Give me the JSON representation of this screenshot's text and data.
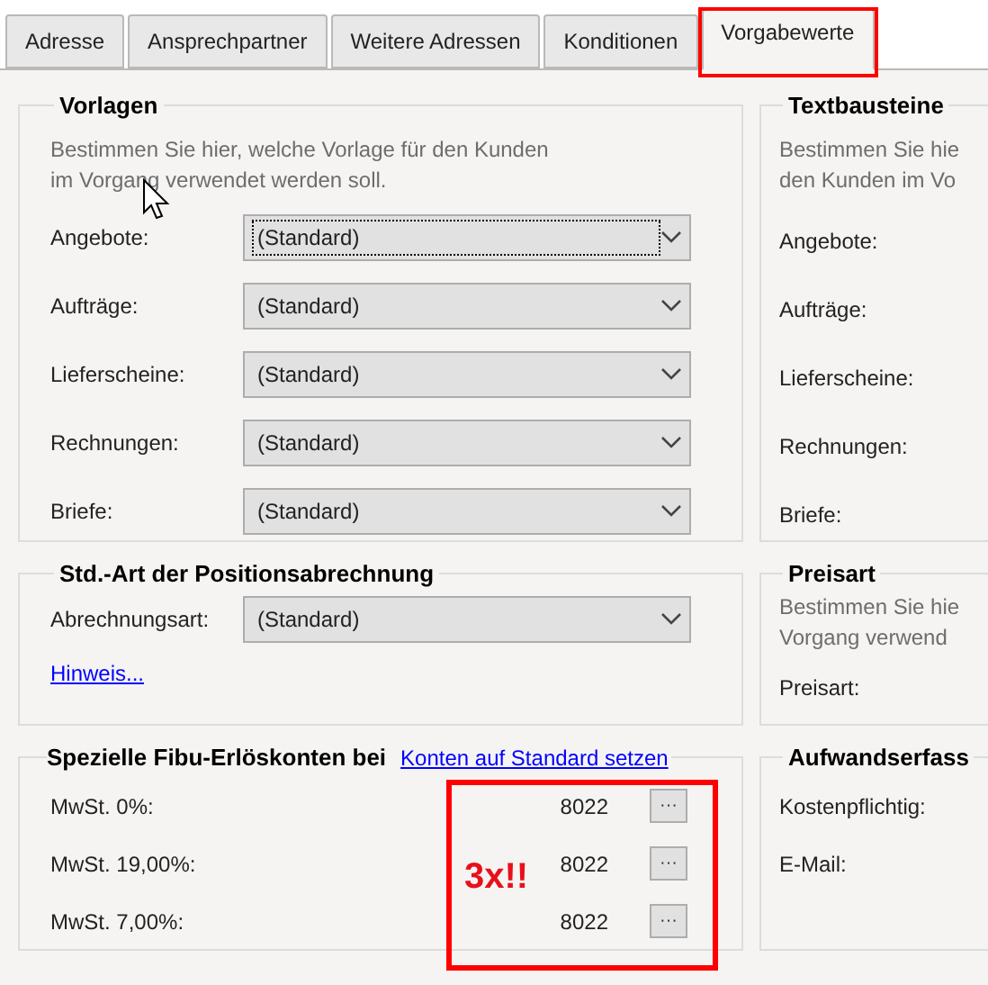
{
  "tabs": [
    {
      "label": "Adresse",
      "selected": false,
      "marked": false
    },
    {
      "label": "Ansprechpartner",
      "selected": false,
      "marked": false
    },
    {
      "label": "Weitere Adressen",
      "selected": false,
      "marked": false
    },
    {
      "label": "Konditionen",
      "selected": false,
      "marked": false
    },
    {
      "label": "Vorgabewerte",
      "selected": true,
      "marked": true
    }
  ],
  "vorlagen": {
    "title": "Vorlagen",
    "description": [
      "Bestimmen Sie hier, welche Vorlage für den Kunden",
      "im Vorgang verwendet werden soll."
    ],
    "rows": [
      {
        "label": "Angebote:",
        "value": "(Standard)",
        "focused": true
      },
      {
        "label": "Aufträge:",
        "value": "(Standard)",
        "focused": false
      },
      {
        "label": "Lieferscheine:",
        "value": "(Standard)",
        "focused": false
      },
      {
        "label": "Rechnungen:",
        "value": "(Standard)",
        "focused": false
      },
      {
        "label": "Briefe:",
        "value": "(Standard)",
        "focused": false
      }
    ]
  },
  "positionsabrechnung": {
    "title": "Std.-Art der Positionsabrechnung",
    "label": "Abrechnungsart:",
    "value": "(Standard)",
    "link": "Hinweis..."
  },
  "fibu": {
    "title": "Spezielle Fibu-Erlöskonten bei",
    "link": "Konten auf Standard setzen",
    "rows": [
      {
        "label": "MwSt. 0%:",
        "value": "8022",
        "button": "···"
      },
      {
        "label": "MwSt. 19,00%:",
        "value": "8022",
        "button": "···"
      },
      {
        "label": "MwSt. 7,00%:",
        "value": "8022",
        "button": "···"
      }
    ],
    "annotation": "3x!!"
  },
  "textbausteine": {
    "title": "Textbausteine",
    "description": [
      "Bestimmen Sie hie",
      "den Kunden im Vo"
    ],
    "labels": [
      "Angebote:",
      "Aufträge:",
      "Lieferscheine:",
      "Rechnungen:",
      "Briefe:"
    ]
  },
  "preisart": {
    "title": "Preisart",
    "description": [
      "Bestimmen Sie hie",
      "Vorgang verwend"
    ],
    "label": "Preisart:"
  },
  "aufwand": {
    "title": "Aufwandserfass",
    "labels": [
      "Kostenpflichtig:",
      "E-Mail:"
    ]
  }
}
